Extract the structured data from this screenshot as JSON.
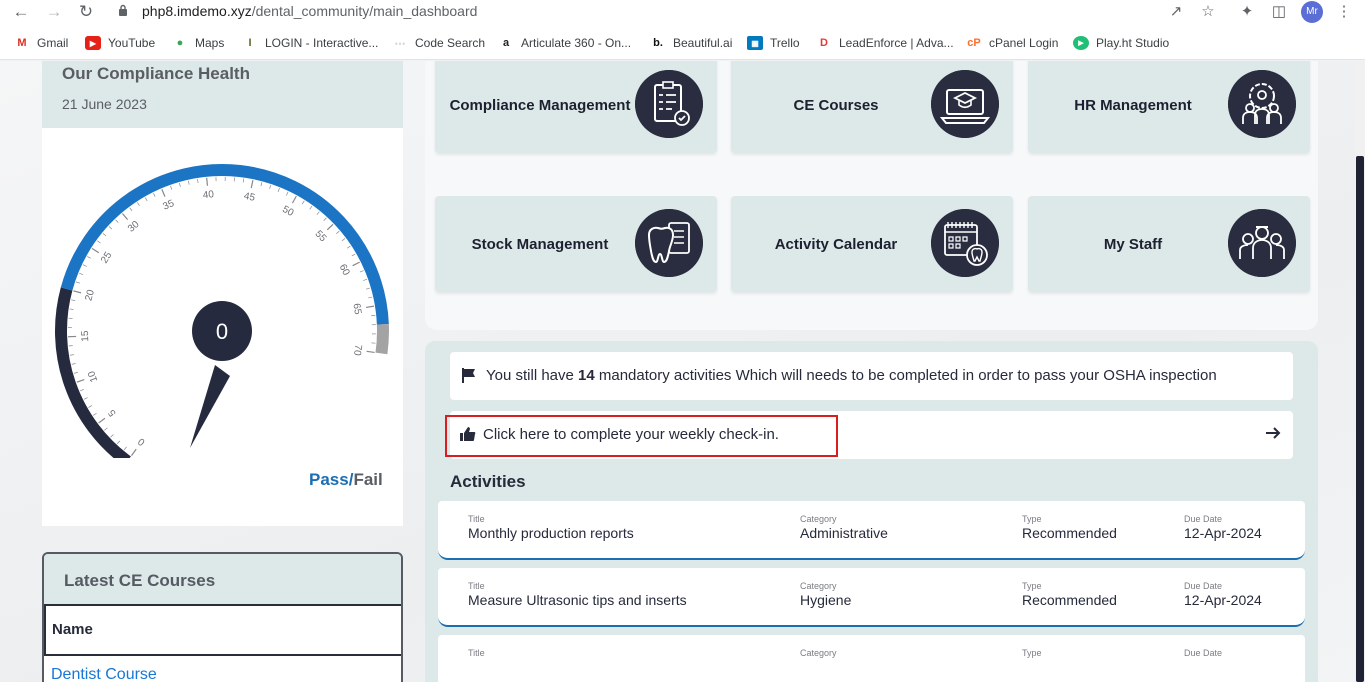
{
  "browser": {
    "url_host": "php8.imdemo.xyz",
    "url_path": "/dental_community/main_dashboard",
    "profile_initials": "Mr",
    "bookmarks": [
      {
        "label": "Gmail",
        "icon": "gmail-icon"
      },
      {
        "label": "YouTube",
        "icon": "youtube-icon"
      },
      {
        "label": "Maps",
        "icon": "maps-icon"
      },
      {
        "label": "LOGIN - Interactive...",
        "icon": "login-icon"
      },
      {
        "label": "Code Search",
        "icon": "code-search-icon"
      },
      {
        "label": "Articulate 360 - On...",
        "icon": "articulate-icon"
      },
      {
        "label": "Beautiful.ai",
        "icon": "beautiful-ai-icon"
      },
      {
        "label": "Trello",
        "icon": "trello-icon"
      },
      {
        "label": "LeadEnforce | Adva...",
        "icon": "leadenforce-icon"
      },
      {
        "label": "cPanel Login",
        "icon": "cpanel-icon"
      },
      {
        "label": "Play.ht Studio",
        "icon": "playht-icon"
      }
    ]
  },
  "compliance": {
    "title": "Our Compliance Health",
    "date": "21 June 2023",
    "score": "0",
    "gauge_ticks": [
      "0",
      "5",
      "10",
      "15",
      "20",
      "25",
      "30",
      "35",
      "40",
      "45",
      "50",
      "55",
      "60",
      "65",
      "70"
    ],
    "pass_label": "Pass/",
    "fail_label": "Fail",
    "colors": {
      "dark": "#262a3f",
      "blue": "#1c74c4",
      "grey": "#a3a3a3"
    }
  },
  "ce_courses": {
    "title": "Latest CE Courses",
    "column_name": "Name",
    "items": [
      "Dentist Course"
    ]
  },
  "tiles": [
    {
      "label": "Compliance Management",
      "icon": "clipboard-checklist-icon"
    },
    {
      "label": "CE Courses",
      "icon": "graduation-laptop-icon"
    },
    {
      "label": "HR Management",
      "icon": "people-gear-icon"
    },
    {
      "label": "Stock Management",
      "icon": "tooth-clipboard-icon"
    },
    {
      "label": "Activity Calendar",
      "icon": "calendar-tooth-icon"
    },
    {
      "label": "My Staff",
      "icon": "staff-group-icon"
    }
  ],
  "notice": {
    "prefix": "You still have ",
    "count": "14",
    "suffix": " mandatory activities Which will needs to be completed in order to pass your OSHA inspection"
  },
  "checkin": {
    "label": "Click here to complete your weekly check-in."
  },
  "activities": {
    "title": "Activities",
    "labels": {
      "title": "Title",
      "category": "Category",
      "type": "Type",
      "due": "Due Date"
    },
    "rows": [
      {
        "title": "Monthly production reports",
        "category": "Administrative",
        "type": "Recommended",
        "due": "12-Apr-2024"
      },
      {
        "title": "Measure Ultrasonic tips and inserts",
        "category": "Hygiene",
        "type": "Recommended",
        "due": "12-Apr-2024"
      },
      {
        "title": "",
        "category": "",
        "type": "",
        "due": ""
      }
    ]
  }
}
